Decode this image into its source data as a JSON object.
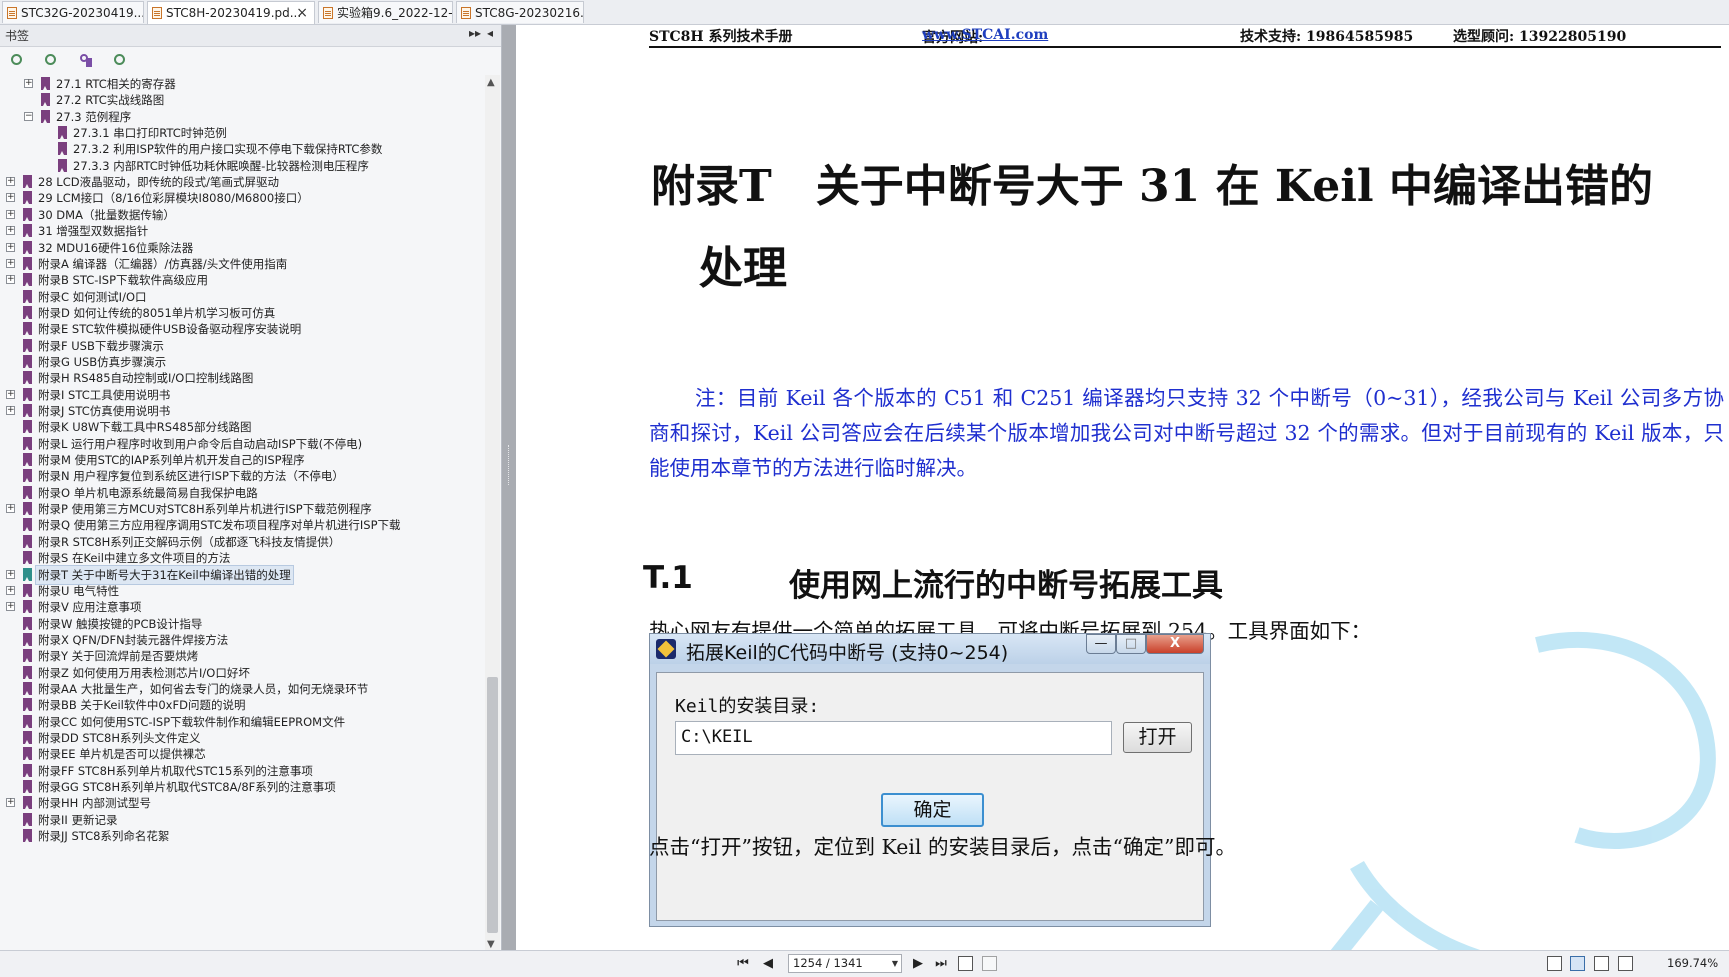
{
  "tabs": [
    {
      "label": "STC32G-20230419....",
      "active": false
    },
    {
      "label": "STC8H-20230419.pd...",
      "active": true
    },
    {
      "label": "实验箱9.6_2022-12-...",
      "active": false
    },
    {
      "label": "STC8G-20230216.p...",
      "active": false
    }
  ],
  "tab_close_glyph": "×",
  "left_panel": {
    "title": "书签",
    "collapse_glyph": "▸▸",
    "close_glyph": "◂",
    "tools": [
      "expand-bookmarks-icon",
      "collapse-bookmarks-icon",
      "find-bookmark-icon",
      "bookmark-options-icon"
    ],
    "bookmarks": [
      {
        "label": "27.1 RTC相关的寄存器",
        "level": 1,
        "toggle": "+"
      },
      {
        "label": "27.2 RTC实战线路图",
        "level": 1,
        "toggle": ""
      },
      {
        "label": "27.3 范例程序",
        "level": 1,
        "toggle": "−"
      },
      {
        "label": "27.3.1 串口打印RTC时钟范例",
        "level": 2,
        "toggle": ""
      },
      {
        "label": "27.3.2 利用ISP软件的用户接口实现不停电下载保持RTC参数",
        "level": 2,
        "toggle": ""
      },
      {
        "label": "27.3.3 内部RTC时钟低功耗休眠唤醒-比较器检测电压程序",
        "level": 2,
        "toggle": ""
      },
      {
        "label": "28 LCD液晶驱动，即传统的段式/笔画式屏驱动",
        "level": 0,
        "toggle": "+"
      },
      {
        "label": "29 LCM接口（8/16位彩屏模块I8080/M6800接口）",
        "level": 0,
        "toggle": "+"
      },
      {
        "label": "30 DMA（批量数据传输）",
        "level": 0,
        "toggle": "+"
      },
      {
        "label": "31 增强型双数据指针",
        "level": 0,
        "toggle": "+"
      },
      {
        "label": "32 MDU16硬件16位乘除法器",
        "level": 0,
        "toggle": "+"
      },
      {
        "label": "附录A 编译器（汇编器）/仿真器/头文件使用指南",
        "level": 0,
        "toggle": "+"
      },
      {
        "label": "附录B STC-ISP下载软件高级应用",
        "level": 0,
        "toggle": "+"
      },
      {
        "label": "附录C 如何测试I/O口",
        "level": 0,
        "toggle": ""
      },
      {
        "label": "附录D 如何让传统的8051单片机学习板可仿真",
        "level": 0,
        "toggle": ""
      },
      {
        "label": "附录E STC软件模拟硬件USB设备驱动程序安装说明",
        "level": 0,
        "toggle": ""
      },
      {
        "label": "附录F USB下载步骤演示",
        "level": 0,
        "toggle": ""
      },
      {
        "label": "附录G USB仿真步骤演示",
        "level": 0,
        "toggle": ""
      },
      {
        "label": "附录H RS485自动控制或I/O口控制线路图",
        "level": 0,
        "toggle": ""
      },
      {
        "label": "附录I STC工具使用说明书",
        "level": 0,
        "toggle": "+"
      },
      {
        "label": "附录J STC仿真使用说明书",
        "level": 0,
        "toggle": "+"
      },
      {
        "label": "附录K U8W下载工具中RS485部分线路图",
        "level": 0,
        "toggle": ""
      },
      {
        "label": "附录L 运行用户程序时收到用户命令后自动启动ISP下载(不停电)",
        "level": 0,
        "toggle": ""
      },
      {
        "label": "附录M 使用STC的IAP系列单片机开发自己的ISP程序",
        "level": 0,
        "toggle": ""
      },
      {
        "label": "附录N 用户程序复位到系统区进行ISP下载的方法（不停电）",
        "level": 0,
        "toggle": ""
      },
      {
        "label": "附录O 单片机电源系统最简易自我保护电路",
        "level": 0,
        "toggle": ""
      },
      {
        "label": "附录P 使用第三方MCU对STC8H系列单片机进行ISP下载范例程序",
        "level": 0,
        "toggle": "+"
      },
      {
        "label": "附录Q 使用第三方应用程序调用STC发布项目程序对单片机进行ISP下载",
        "level": 0,
        "toggle": ""
      },
      {
        "label": "附录R STC8H系列正交解码示例（成都逐飞科技友情提供）",
        "level": 0,
        "toggle": ""
      },
      {
        "label": "附录S 在Keil中建立多文件项目的方法",
        "level": 0,
        "toggle": ""
      },
      {
        "label": "附录T 关于中断号大于31在Keil中编译出错的处理",
        "level": 0,
        "toggle": "+",
        "selected": true
      },
      {
        "label": "附录U 电气特性",
        "level": 0,
        "toggle": "+"
      },
      {
        "label": "附录V 应用注意事项",
        "level": 0,
        "toggle": "+"
      },
      {
        "label": "附录W 触摸按键的PCB设计指导",
        "level": 0,
        "toggle": ""
      },
      {
        "label": "附录X QFN/DFN封装元器件焊接方法",
        "level": 0,
        "toggle": ""
      },
      {
        "label": "附录Y 关于回流焊前是否要烘烤",
        "level": 0,
        "toggle": ""
      },
      {
        "label": "附录Z 如何使用万用表检测芯片I/O口好坏",
        "level": 0,
        "toggle": ""
      },
      {
        "label": "附录AA 大批量生产，如何省去专门的烧录人员，如何无烧录环节",
        "level": 0,
        "toggle": ""
      },
      {
        "label": "附录BB 关于Keil软件中0xFD问题的说明",
        "level": 0,
        "toggle": ""
      },
      {
        "label": "附录CC 如何使用STC-ISP下载软件制作和编辑EEPROM文件",
        "level": 0,
        "toggle": ""
      },
      {
        "label": "附录DD STC8H系列头文件定义",
        "level": 0,
        "toggle": ""
      },
      {
        "label": "附录EE 单片机是否可以提供裸芯",
        "level": 0,
        "toggle": ""
      },
      {
        "label": "附录FF STC8H系列单片机取代STC15系列的注意事项",
        "level": 0,
        "toggle": ""
      },
      {
        "label": "附录GG STC8H系列单片机取代STC8A/8F系列的注意事项",
        "level": 0,
        "toggle": ""
      },
      {
        "label": "附录HH 内部测试型号",
        "level": 0,
        "toggle": "+"
      },
      {
        "label": "附录II 更新记录",
        "level": 0,
        "toggle": ""
      },
      {
        "label": "附录JJ STC8系列命名花絮",
        "level": 0,
        "toggle": ""
      }
    ]
  },
  "document": {
    "header": {
      "manual": "STC8H 系列技术手册",
      "site_label": "官方网站: ",
      "site_url": "www.STCAI.com",
      "support": "技术支持: 19864585985",
      "advisor": "选型顾问: 13922805190"
    },
    "chapter_title_line1": "附录T　关于中断号大于 31 在 Keil 中编译出错的",
    "chapter_title_line2": "处理",
    "note": "注：目前 Keil 各个版本的 C51 和 C251 编译器均只支持 32 个中断号（0~31），经我公司与 Keil 公司多方协商和探讨，Keil 公司答应会在后续某个版本增加我公司对中断号超过 32 个的需求。但对于目前现有的 Keil 版本，只能使用本章节的方法进行临时解决。",
    "section_number": "T.1",
    "section_title": "使用网上流行的中断号拓展工具",
    "intro": "热心网友有提供一个简单的拓展工具，可将中断号拓展到 254。工具界面如下：",
    "dialog": {
      "title": "拓展Keil的C代码中断号 (支持0~254)",
      "min": "—",
      "max": "□",
      "close": "X",
      "label": "Keil的安装目录:",
      "path": "C:\\KEIL",
      "open_button": "打开",
      "ok_button": "确定"
    },
    "after": "点击“打开”按钮，定位到 Keil 的安装目录后，点击“确定”即可。"
  },
  "statusbar": {
    "first": "⏮",
    "prev": "◀",
    "page_value": "1254 / 1341",
    "next": "▶",
    "last": "⏭",
    "zoom": "169.74%"
  },
  "colors": {
    "note_text": "#1f2fcf",
    "link": "#1f3fbf",
    "bookmark_icon": "#7a3f7e",
    "watermark": "#8fd3ef"
  }
}
